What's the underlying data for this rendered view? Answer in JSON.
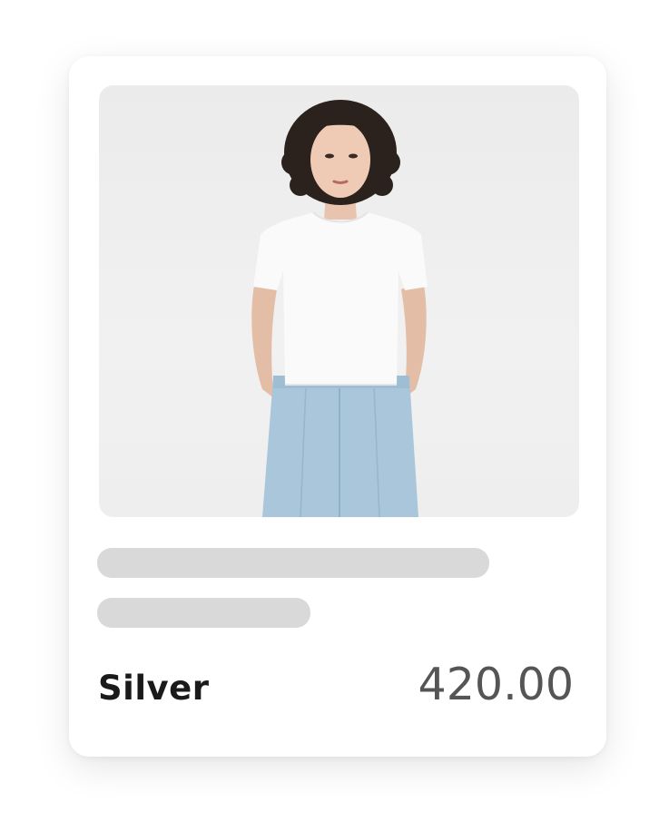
{
  "product": {
    "name": "Silver",
    "price": "420.00",
    "image_icon": "product-photo-woman-white-tee-blue-trousers"
  },
  "colors": {
    "card_background": "#ffffff",
    "skeleton": "#d9d9d9",
    "name_text": "#1a1a1a",
    "price_text": "#555555",
    "image_background": "#ededed"
  }
}
